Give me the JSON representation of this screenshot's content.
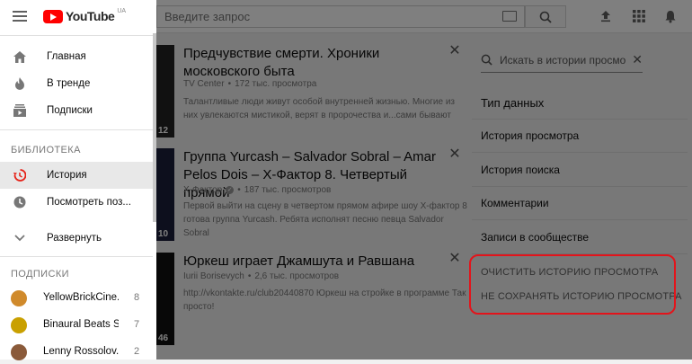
{
  "header": {
    "search_placeholder": "Введите запрос"
  },
  "sidebar": {
    "logo_text": "YouTube",
    "logo_region": "UA",
    "nav": [
      {
        "label": "Главная",
        "icon": "home-icon"
      },
      {
        "label": "В тренде",
        "icon": "flame-icon"
      },
      {
        "label": "Подписки",
        "icon": "subscriptions-icon"
      }
    ],
    "library_title": "БИБЛИОТЕКА",
    "library": [
      {
        "label": "История",
        "icon": "history-icon",
        "active": true
      },
      {
        "label": "Посмотреть поз...",
        "icon": "clock-icon"
      },
      {
        "label": "Развернуть",
        "icon": "chevron-down-icon"
      }
    ],
    "subs_title": "ПОДПИСКИ",
    "subscriptions": [
      {
        "label": "YellowBrickCine...",
        "count": "8",
        "color": "#d08a2b"
      },
      {
        "label": "Binaural Beats S...",
        "count": "7",
        "color": "#c9a000"
      },
      {
        "label": "Lenny Rossolov...",
        "count": "2",
        "color": "#8a5a3a"
      }
    ]
  },
  "videos": [
    {
      "title": "Предчувствие смерти. Хроники московского быта",
      "channel": "TV Center",
      "views": "172 тыс. просмотра",
      "description": "Талантливые люди живут особой внутренней жизнью. Многие из них увлекаются мистикой, верят в пророчества и...сами бывают",
      "duration": "12"
    },
    {
      "title": "Группа Yurcash – Salvador Sobral – Amar Pelos Dois – Х-Фактор 8. Четвертый прямой",
      "channel": "Х-Фактор",
      "views": "187 тыс. просмотров",
      "description": "Первой выйти на сцену в четвертом прямом афире шоу Х-фактор 8 готова группа Yurcash. Ребята исполнят песню певца Salvador Sobral",
      "duration": "10"
    },
    {
      "title": "Юркеш играет Джамшута и Равшана",
      "channel": "Iurii Borisevych",
      "views": "2,6 тыс. просмотров",
      "description": "http://vkontakte.ru/club20440870 Юркеш на стройке в программе Так просто!",
      "duration": "46"
    }
  ],
  "right_panel": {
    "search_placeholder": "Искать в истории просмотра",
    "data_type_title": "Тип данных",
    "types": [
      "История просмотра",
      "История поиска",
      "Комментарии",
      "Записи в сообществе"
    ],
    "actions": [
      "ОЧИСТИТЬ ИСТОРИЮ ПРОСМОТРА",
      "НЕ СОХРАНЯТЬ ИСТОРИЮ ПРОСМОТРА"
    ],
    "highlight_color": "#e3141b"
  }
}
